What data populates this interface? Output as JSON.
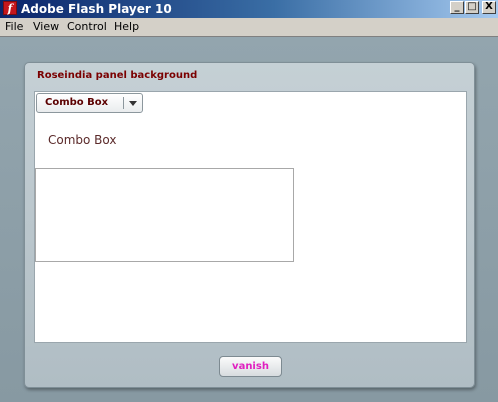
{
  "window": {
    "title": "Adobe Flash Player 10",
    "app_icon_glyph": "f",
    "controls": {
      "minimize": "_",
      "maximize": "□",
      "close": "X"
    }
  },
  "menu": {
    "file": "File",
    "view": "View",
    "control": "Control",
    "help": "Help"
  },
  "panel": {
    "title": "Roseindia panel background",
    "combo_box": {
      "selected": "Combo Box"
    },
    "combo_text": "Combo Box",
    "vanish_label": "vanish"
  },
  "colors": {
    "panel_title": "#7a0000",
    "vanish_text": "#e020c0",
    "stage_bg": "#8fa1aa"
  }
}
